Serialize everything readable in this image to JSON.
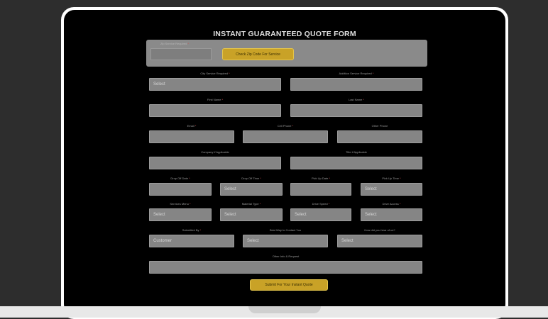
{
  "form": {
    "title": "INSTANT GUARANTEED QUOTE FORM",
    "zip": {
      "label": "Zip Service Required",
      "button": "Check Zip Code For Service"
    },
    "labels": {
      "city": "City Service Required",
      "addl": "Addition Service Required",
      "first": "First Name",
      "last": "Last Name",
      "email": "Email",
      "cell": "Cell Phone",
      "other_phone": "Other Phone",
      "company": "Company if Applicable",
      "title": "Title if Applicable",
      "dropoff_date": "Drop Off Date",
      "dropoff_time": "Drop Off Time",
      "pickup_date": "Pick Up Date",
      "pickup_time": "Pick Up Time",
      "services": "Services Menu",
      "material": "Material Type",
      "drive_speed": "Drive Speed",
      "drive_access": "Drive Access",
      "submitted_by": "Submitted By",
      "best_way": "Best Way to Contact You",
      "hear": "How did you hear of us?",
      "other_info": "Other Info & Request"
    },
    "values": {
      "city": "Select",
      "dropoff_time": "Select",
      "pickup_time": "Select",
      "services": "Select",
      "material": "Select",
      "drive_speed": "Select",
      "drive_access": "Select",
      "submitted_by": "Customer",
      "best_way": "Select",
      "hear": "Select"
    },
    "submit": "Submit For Your Instant Quote",
    "colors": {
      "accent": "#c9a227",
      "field": "#858585",
      "bg": "#000000"
    }
  }
}
